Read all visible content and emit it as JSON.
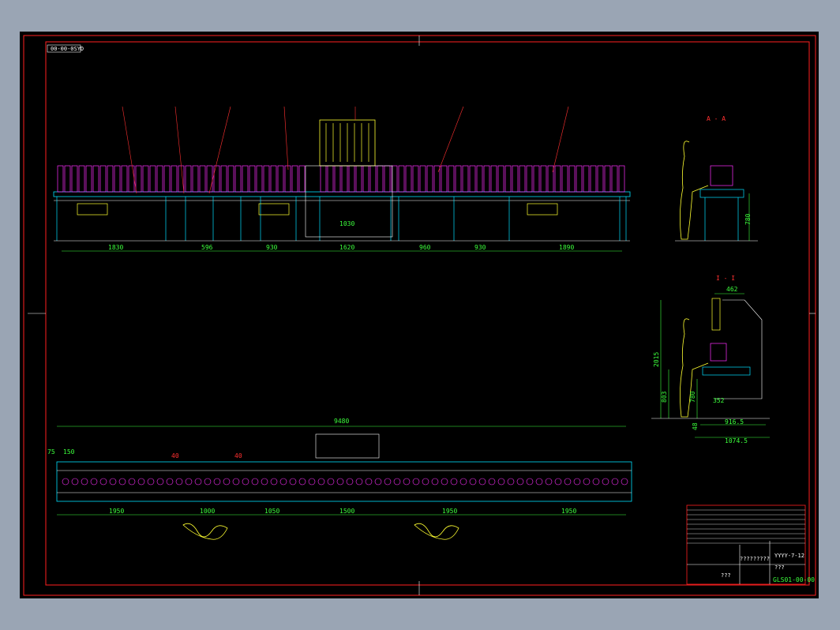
{
  "drawing": {
    "tag_top_left": "00-00-0SYD",
    "section_a_label": "A - A",
    "section_b_label": "I - I",
    "title_block": {
      "date": "YYYY-7-12",
      "field_q": "???",
      "field_q2": "?????????",
      "field_q3": "???",
      "drawing_no": "GLS01-00-00"
    }
  },
  "dims_top": [
    "1830",
    "596",
    "930",
    "1030",
    "1620",
    "960",
    "930",
    "1890"
  ],
  "dims_bottom": [
    "75",
    "150",
    "40",
    "40",
    "9480",
    "1950",
    "1000",
    "1050",
    "1500",
    "1950",
    "1950"
  ],
  "dims_side_a": [
    "780"
  ],
  "dims_side_b": [
    "462",
    "2015",
    "803",
    "780",
    "352",
    "48",
    "916.5",
    "1074.5"
  ],
  "colors": {
    "frame": "#ff2020",
    "line": "#ffffff",
    "dim": "#3cff3c",
    "cyan": "#00e0ff",
    "magenta": "#ff30ff",
    "yellow": "#ffff30"
  }
}
